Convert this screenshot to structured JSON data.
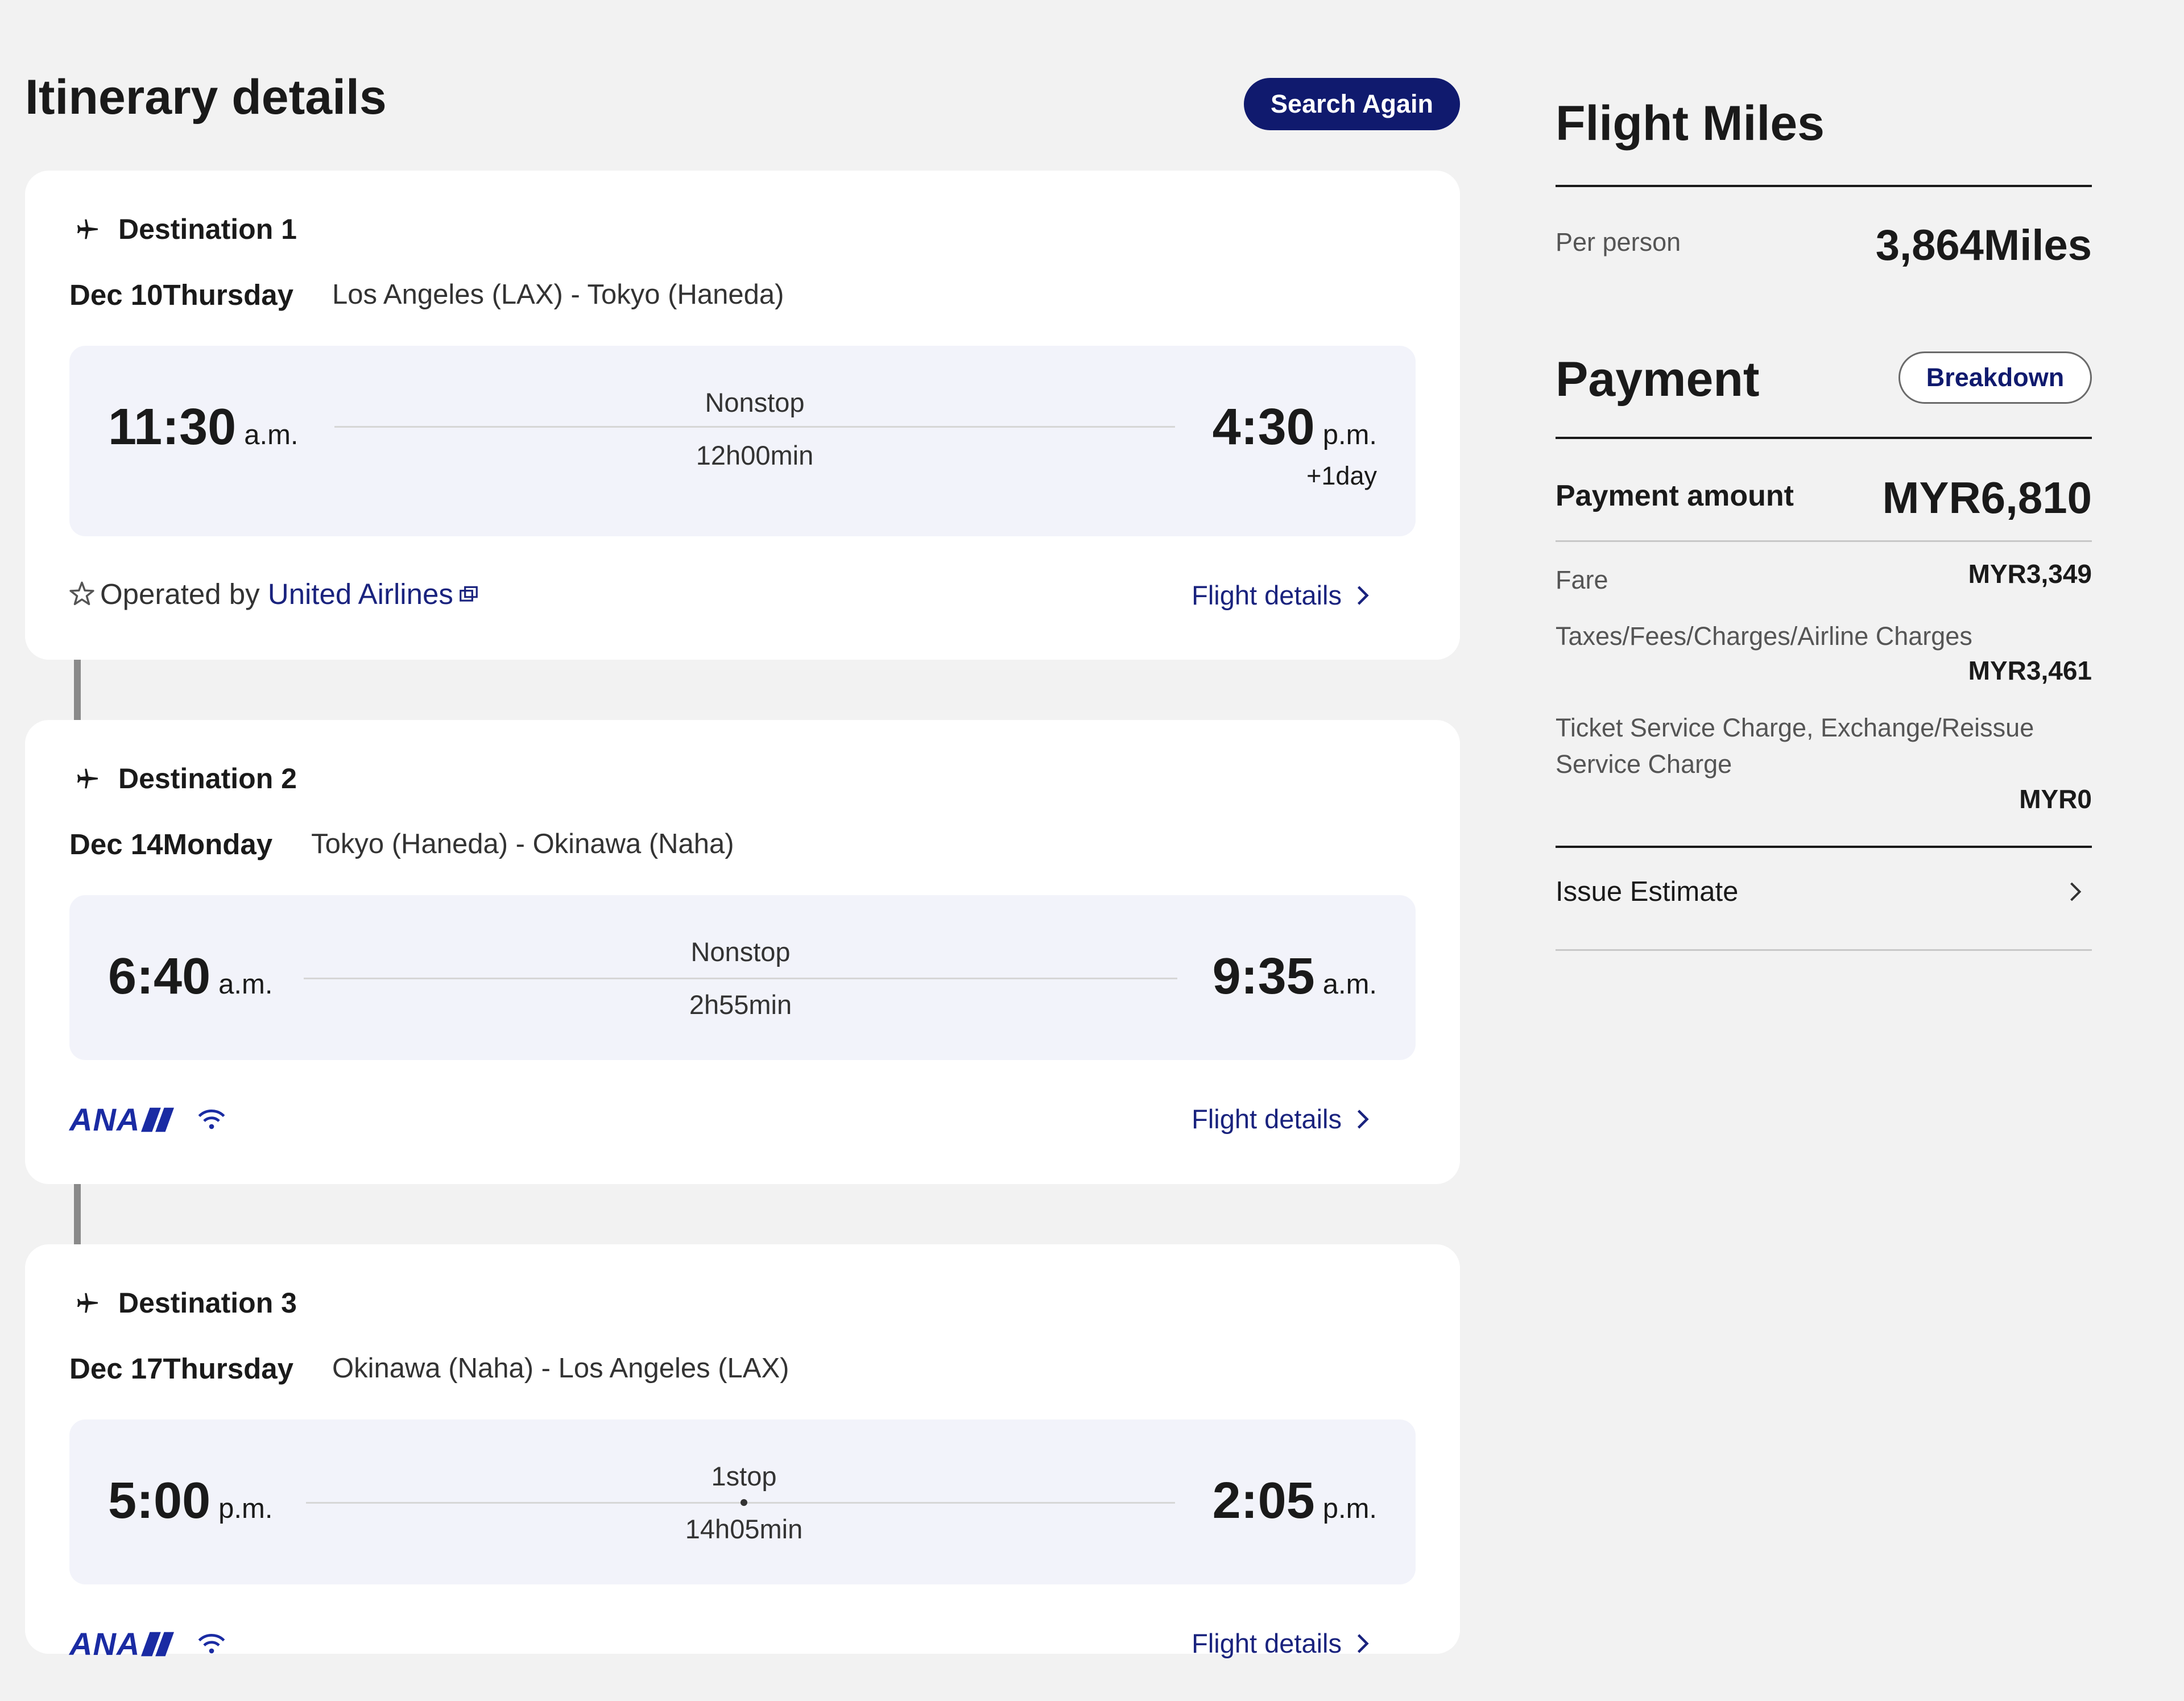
{
  "header": {
    "title": "Itinerary details",
    "search_again_label": "Search Again"
  },
  "destinations": [
    {
      "label": "Destination 1",
      "date": "Dec 10Thursday",
      "route": "Los Angeles (LAX) - Tokyo (Haneda)",
      "depart_time": "11:30",
      "depart_ampm": "a.m.",
      "arrive_time": "4:30",
      "arrive_ampm": "p.m.",
      "plus_day": "+1day",
      "stops": "Nonstop",
      "duration": "12h00min",
      "operated_by_prefix": "Operated by",
      "operated_by_airline": "United Airlines",
      "details_label": "Flight details"
    },
    {
      "label": "Destination 2",
      "date": "Dec 14Monday",
      "route": "Tokyo (Haneda) - Okinawa (Naha)",
      "depart_time": "6:40",
      "depart_ampm": "a.m.",
      "arrive_time": "9:35",
      "arrive_ampm": "a.m.",
      "stops": "Nonstop",
      "duration": "2h55min",
      "carrier_logo": "ANA",
      "details_label": "Flight details"
    },
    {
      "label": "Destination 3",
      "date": "Dec 17Thursday",
      "route": "Okinawa (Naha) - Los Angeles (LAX)",
      "depart_time": "5:00",
      "depart_ampm": "p.m.",
      "arrive_time": "2:05",
      "arrive_ampm": "p.m.",
      "stops": "1stop",
      "duration": "14h05min",
      "carrier_logo": "ANA",
      "details_label": "Flight details"
    }
  ],
  "miles": {
    "title": "Flight Miles",
    "per_person_label": "Per person",
    "per_person_value": "3,864Miles"
  },
  "payment": {
    "title": "Payment",
    "breakdown_label": "Breakdown",
    "amount_label": "Payment amount",
    "amount_value": "MYR6,810",
    "fare_label": "Fare",
    "fare_value": "MYR3,349",
    "taxes_label": "Taxes/Fees/Charges/Airline Charges",
    "taxes_value": "MYR3,461",
    "service_label_1": "Ticket Service Charge, Exchange/Reissue",
    "service_label_2": "Service Charge",
    "service_value": "MYR0",
    "issue_estimate_label": "Issue Estimate"
  },
  "colors": {
    "primary_navy": "#101a6e",
    "link_blue": "#1a237e",
    "ana_blue": "#1a2ba3",
    "background": "#f2f2f2",
    "time_box_bg": "#f2f3fa"
  },
  "icons": {
    "plane": "plane-icon",
    "star_alliance": "star-alliance-icon",
    "external": "external-link-icon",
    "wifi": "wifi-icon",
    "chevron": "chevron-right-icon"
  }
}
